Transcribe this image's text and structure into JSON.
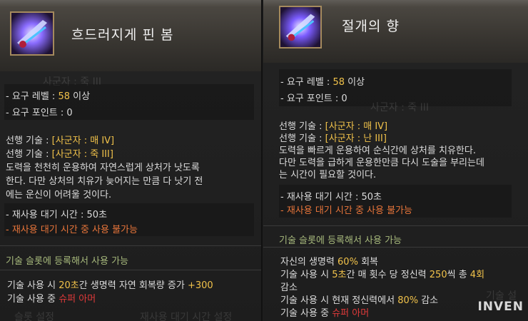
{
  "left": {
    "title": "흐드러지게 핀 봄",
    "bg_ghost_top": "사군자 : 죽 III",
    "bg_ghost_bottom_1": "슬롯 설정",
    "bg_ghost_bottom_2": "재사용 대기 시간 설정",
    "req_level_label": "- 요구 레벨 : ",
    "req_level_value": "58",
    "req_level_suffix": " 이상",
    "req_point": "- 요구 포인트 : 0",
    "pre_skill_label": "선행 기술 : ",
    "pre_skill_1": "[사군자 : 매 IV]",
    "pre_skill_2": "[사군자 : 죽 III]",
    "desc_1": "도력을 천천히 운용하여 자연스럽게 상처가 낫도록",
    "desc_2": "한다. 다만 상처의 치유가 늦어지는 만큼 다 낫기 전",
    "desc_3": "에는 운신이 어려울 것이다.",
    "cooldown": "- 재사용 대기 시간        : 50초",
    "cooldown_note": "- 재사용 대기 시간 중 사용 불가능",
    "slot_note": "기술 슬롯에 등록해서 사용 가능",
    "effect_1a": "기술 사용 시 ",
    "effect_1b": "20초",
    "effect_1c": "간 생명력 자연 회복량 증가 ",
    "effect_1d": "+300",
    "effect_2a": "기술 사용 중 ",
    "effect_2b": "슈퍼 아머"
  },
  "right": {
    "title": "절개의 향",
    "bg_ghost_top": "사군자 : 죽 III",
    "bg_ghost_mid": "기술 설",
    "req_level_label": "- 요구 레벨 : ",
    "req_level_value": "58",
    "req_level_suffix": " 이상",
    "req_point": "- 요구 포인트 : 0",
    "pre_skill_label": "선행 기술 : ",
    "pre_skill_1": "[사군자 : 매 IV]",
    "pre_skill_2": "[사군자 : 난 III]",
    "desc_1": "도력을 빠르게 운용하여 순식간에 상처를 치유한다.",
    "desc_2": "다만 도력을 급하게 운용한만큼 다시 도술을 부리는데",
    "desc_3": "는 시간이 필요할 것이다.",
    "cooldown": "- 재사용 대기 시간        : 50초",
    "cooldown_note": "- 재사용 대기 시간 중 사용 불가능",
    "slot_note": "기술 슬롯에 등록해서 사용 가능",
    "effect_1a": "자신의 생명력 ",
    "effect_1b": "60%",
    "effect_1c": " 회복",
    "effect_2a": "기술 사용 시 ",
    "effect_2b": "5초",
    "effect_2c": "간 매 횟수 당 정신력 ",
    "effect_2d": "250",
    "effect_2e": "씩 총 ",
    "effect_2f": "4회",
    "effect_3": "감소",
    "effect_4a": "기술 사용 시 현재 정신력에서 ",
    "effect_4b": "80%",
    "effect_4c": " 감소",
    "effect_5a": "기술 사용 중 ",
    "effect_5b": "슈퍼 아머"
  },
  "watermark": "INVEN",
  "colors": {
    "accent_yellow": "#f1c24a",
    "warning_orange": "#e8753a",
    "armor_red": "#e13a3a",
    "slot_green": "#a7b97c"
  }
}
